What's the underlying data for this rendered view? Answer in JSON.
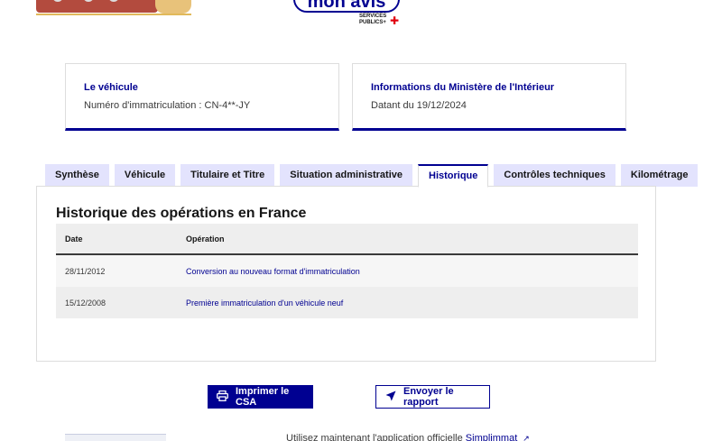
{
  "header": {
    "badge_text": "mon avis",
    "sp_logo_line1": "SERVICES",
    "sp_logo_line2": "PUBLICS+"
  },
  "cards": [
    {
      "title": "Le véhicule",
      "text": "Numéro d'immatriculation : CN-4**-JY"
    },
    {
      "title": "Informations du Ministère de l'Intérieur",
      "text": "Datant du 19/12/2024"
    }
  ],
  "tabs": [
    {
      "label": "Synthèse",
      "active": false
    },
    {
      "label": "Véhicule",
      "active": false
    },
    {
      "label": "Titulaire et Titre",
      "active": false
    },
    {
      "label": "Situation administrative",
      "active": false
    },
    {
      "label": "Historique",
      "active": true
    },
    {
      "label": "Contrôles techniques",
      "active": false
    },
    {
      "label": "Kilométrage",
      "active": false
    }
  ],
  "panel": {
    "title": "Historique des opérations en France",
    "columns": {
      "date": "Date",
      "operation": "Opération"
    },
    "rows": [
      {
        "date": "28/11/2012",
        "operation": "Conversion au nouveau format d'immatriculation"
      },
      {
        "date": "15/12/2008",
        "operation": "Première immatriculation d'un véhicule neuf"
      }
    ]
  },
  "actions": {
    "print_label": "Imprimer le CSA",
    "send_label": "Envoyer le rapport"
  },
  "footer": {
    "text": "Utilisez maintenant l'application officielle",
    "link": "Simplimmat"
  },
  "colors": {
    "primary": "#000091",
    "tab_bg": "#e3e3fd",
    "border": "#dddddd"
  }
}
